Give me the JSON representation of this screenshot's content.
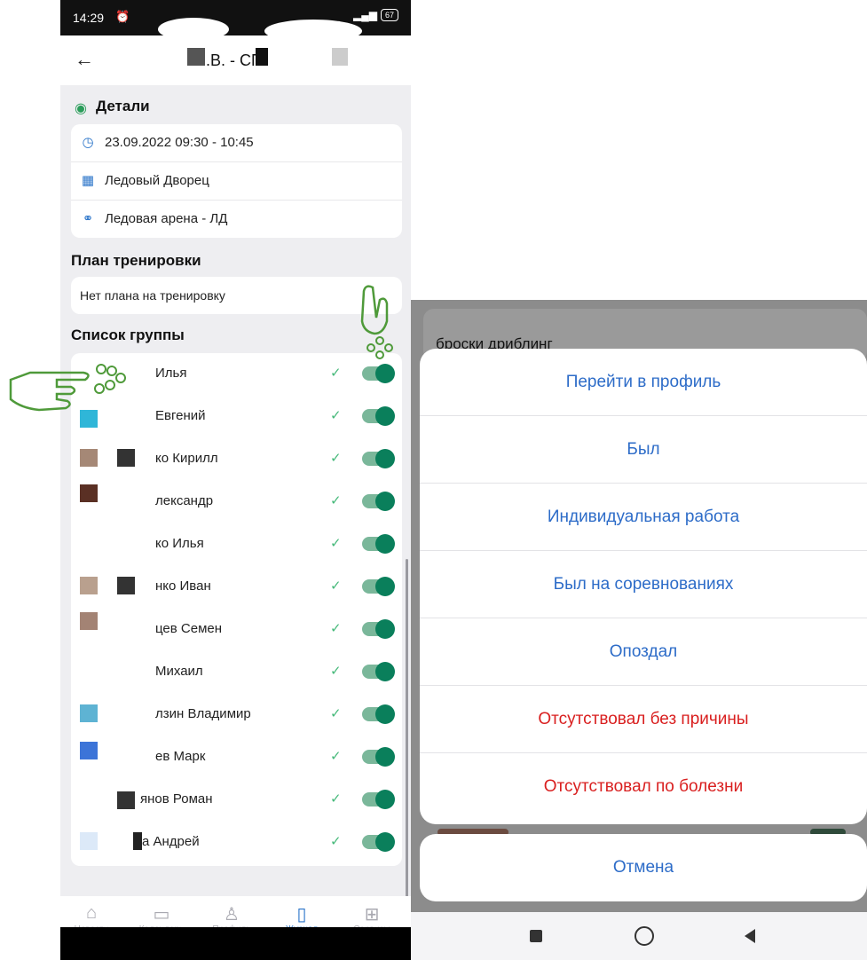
{
  "status": {
    "time": "14:29",
    "battery": "67"
  },
  "header": {
    "title": ".В. - СП"
  },
  "details": {
    "title": "Детали",
    "rows": [
      {
        "icon": "clock-icon",
        "text": "23.09.2022 09:30 - 10:45"
      },
      {
        "icon": "building-icon",
        "text": "Ледовый Дворец"
      },
      {
        "icon": "link-icon",
        "text": "Ледовая арена - ЛД"
      }
    ]
  },
  "plan": {
    "title": "План тренировки",
    "text": "Нет плана на тренировку"
  },
  "group": {
    "title": "Список группы",
    "members": [
      {
        "name": "Илья",
        "present": true
      },
      {
        "name": "Евгений",
        "present": true
      },
      {
        "name": "ко Кирилл",
        "present": true
      },
      {
        "name": "лександр",
        "present": true
      },
      {
        "name": "ко Илья",
        "present": true
      },
      {
        "name": "нко Иван",
        "present": true
      },
      {
        "name": "цев Семен",
        "present": true
      },
      {
        "name": "Михаил",
        "present": true
      },
      {
        "name": "лзин Владимир",
        "present": true
      },
      {
        "name": "ев Марк",
        "present": true
      },
      {
        "name": "янов Роман",
        "present": true
      },
      {
        "name": "а Андрей",
        "present": true
      }
    ]
  },
  "nav": [
    {
      "label": "Новости",
      "icon": "home-icon",
      "active": false
    },
    {
      "label": "Календарь",
      "icon": "calendar-icon",
      "active": false
    },
    {
      "label": "Профиль",
      "icon": "profile-icon",
      "active": false
    },
    {
      "label": "Журнал",
      "icon": "journal-icon",
      "active": true
    },
    {
      "label": "Сервисы",
      "icon": "grid-icon",
      "active": false
    }
  ],
  "sheet": {
    "background_title": "броски дриблинг",
    "actions": [
      {
        "label": "Перейти в профиль",
        "style": "normal"
      },
      {
        "label": "Был",
        "style": "normal"
      },
      {
        "label": "Индивидуальная работа",
        "style": "normal"
      },
      {
        "label": "Был на соревнованиях",
        "style": "normal"
      },
      {
        "label": "Опоздал",
        "style": "normal"
      },
      {
        "label": "Отсутствовал без причины",
        "style": "danger"
      },
      {
        "label": "Отсутствовал по болезни",
        "style": "danger"
      }
    ],
    "cancel": "Отмена"
  },
  "colors": {
    "accent": "#2d6cc8",
    "danger": "#d91f1f",
    "toggle": "#0a7f5b",
    "check": "#46b97a"
  }
}
